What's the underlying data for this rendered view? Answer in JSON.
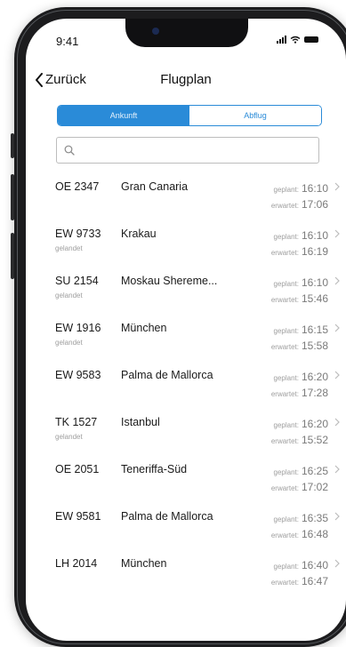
{
  "status_bar": {
    "time": "9:41"
  },
  "nav": {
    "back_label": "Zurück",
    "title": "Flugplan"
  },
  "segments": [
    {
      "label": "Ankunft",
      "active": true
    },
    {
      "label": "Abflug",
      "active": false
    }
  ],
  "search": {
    "placeholder": "",
    "value": ""
  },
  "labels": {
    "planned": "geplant:",
    "expected": "erwartet:"
  },
  "flights": [
    {
      "number": "OE 2347",
      "destination": "Gran Canaria",
      "status": "",
      "planned": "16:10",
      "expected": "17:06"
    },
    {
      "number": "EW 9733",
      "destination": "Krakau",
      "status": "gelandet",
      "planned": "16:10",
      "expected": "16:19"
    },
    {
      "number": "SU 2154",
      "destination": "Moskau Shereme...",
      "status": "gelandet",
      "planned": "16:10",
      "expected": "15:46"
    },
    {
      "number": "EW 1916",
      "destination": "München",
      "status": "gelandet",
      "planned": "16:15",
      "expected": "15:58"
    },
    {
      "number": "EW 9583",
      "destination": "Palma de Mallorca",
      "status": "",
      "planned": "16:20",
      "expected": "17:28"
    },
    {
      "number": "TK 1527",
      "destination": "Istanbul",
      "status": "gelandet",
      "planned": "16:20",
      "expected": "15:52"
    },
    {
      "number": "OE 2051",
      "destination": "Teneriffa-Süd",
      "status": "",
      "planned": "16:25",
      "expected": "17:02"
    },
    {
      "number": "EW 9581",
      "destination": "Palma de Mallorca",
      "status": "",
      "planned": "16:35",
      "expected": "16:48"
    },
    {
      "number": "LH 2014",
      "destination": "München",
      "status": "",
      "planned": "16:40",
      "expected": "16:47"
    }
  ],
  "colors": {
    "accent": "#2a8bd8",
    "frame": "#1c1c1e",
    "muted": "#9e9e9e"
  },
  "icons": {
    "back": "chevron-left-icon",
    "search": "search-icon",
    "row": "chevron-right-icon"
  }
}
